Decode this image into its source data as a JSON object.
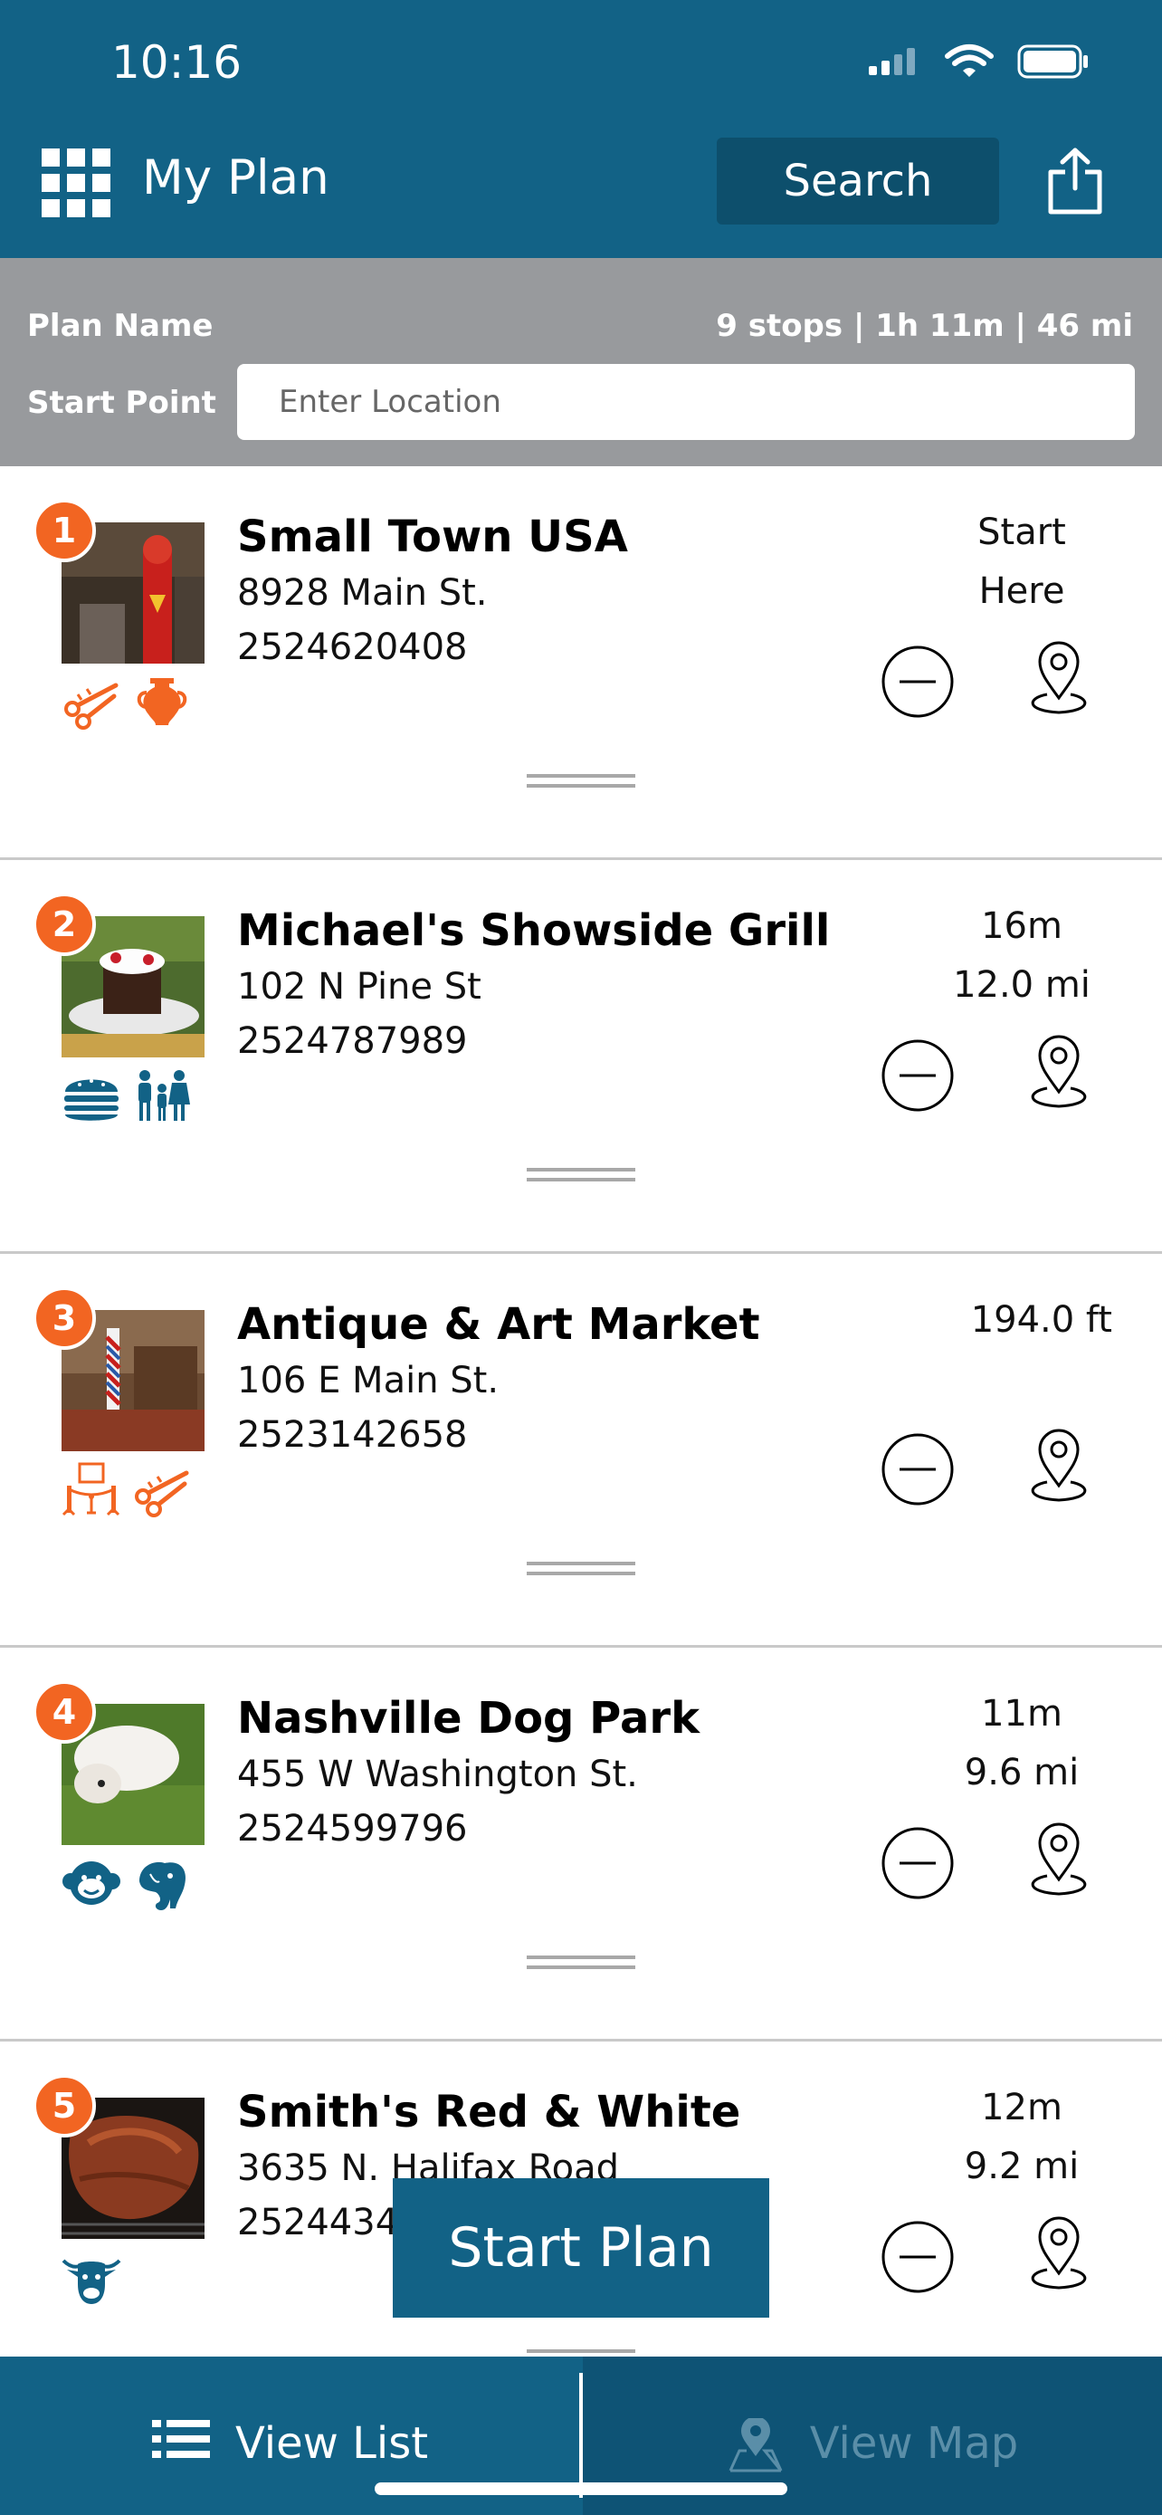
{
  "status_bar": {
    "time": "10:16"
  },
  "header": {
    "title": "My Plan",
    "search_label": "Search"
  },
  "plan": {
    "name_label": "Plan Name",
    "stats": "9 stops | 1h 11m | 46 mi",
    "start_label": "Start Point",
    "start_placeholder": "Enter Location"
  },
  "stops": [
    {
      "number": "1",
      "name": "Small Town USA",
      "address": "8928 Main St.",
      "phone": "2524620408",
      "meta1": "Start",
      "meta2": "Here",
      "categories": [
        "scissors-icon",
        "vase-icon"
      ]
    },
    {
      "number": "2",
      "name": "Michael's Showside Grill",
      "address": "102 N Pine St",
      "phone": "2524787989",
      "meta1": "16m",
      "meta2": "12.0 mi",
      "categories": [
        "burger-icon",
        "family-icon"
      ]
    },
    {
      "number": "3",
      "name": "Antique & Art Market",
      "address": "106 E Main St.",
      "phone": "2523142658",
      "meta1": "",
      "meta2": "194.0 ft",
      "categories": [
        "exhibit-icon",
        "scissors-icon"
      ]
    },
    {
      "number": "4",
      "name": "Nashville Dog Park",
      "address": "455 W Washington St.",
      "phone": "2524599796",
      "meta1": "11m",
      "meta2": "9.6 mi",
      "categories": [
        "monkey-icon",
        "elephant-icon"
      ]
    },
    {
      "number": "5",
      "name": "Smith's Red & White",
      "address": "3635 N. Halifax Road",
      "phone": "2524434312",
      "meta1": "12m",
      "meta2": "9.2 mi",
      "categories": [
        "cow-icon"
      ]
    }
  ],
  "start_plan_label": "Start Plan",
  "bottom_tabs": {
    "list_label": "View List",
    "map_label": "View Map"
  },
  "colors": {
    "brand_blue": "#126286",
    "accent_orange": "#f26522",
    "plan_bar_gray": "#989a9d"
  }
}
